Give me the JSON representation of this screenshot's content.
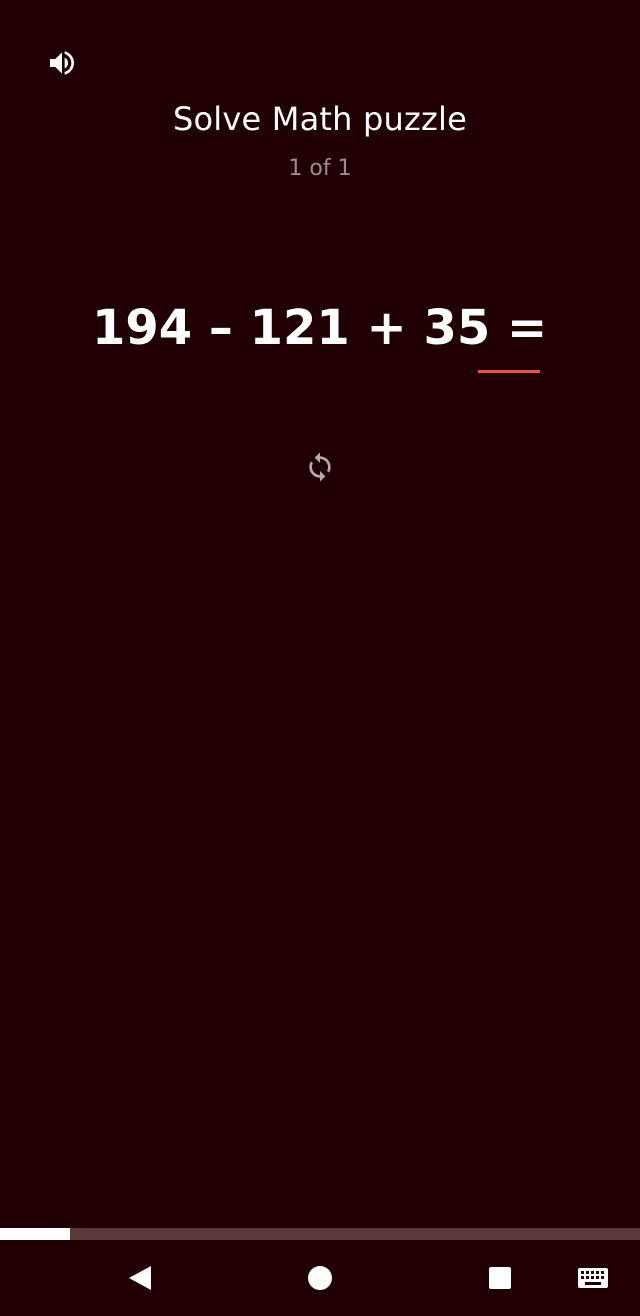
{
  "header": {
    "title": "Solve Math puzzle",
    "counter": "1 of 1",
    "sound_icon": "speaker-icon"
  },
  "puzzle": {
    "equation": "194 – 121 + 35 =",
    "answer_value": "",
    "answer_underline_color": "#e8563a",
    "refresh_icon": "refresh-icon"
  },
  "progress": {
    "fraction": 0.11
  },
  "navigation": {
    "back_icon": "back-triangle-icon",
    "home_icon": "home-circle-icon",
    "recents_icon": "recents-square-icon",
    "keyboard_icon": "keyboard-icon"
  },
  "colors": {
    "background": "#200002",
    "accent": "#e8563a",
    "muted_text": "#a08c8c",
    "progress_track": "#5a3a3a"
  }
}
